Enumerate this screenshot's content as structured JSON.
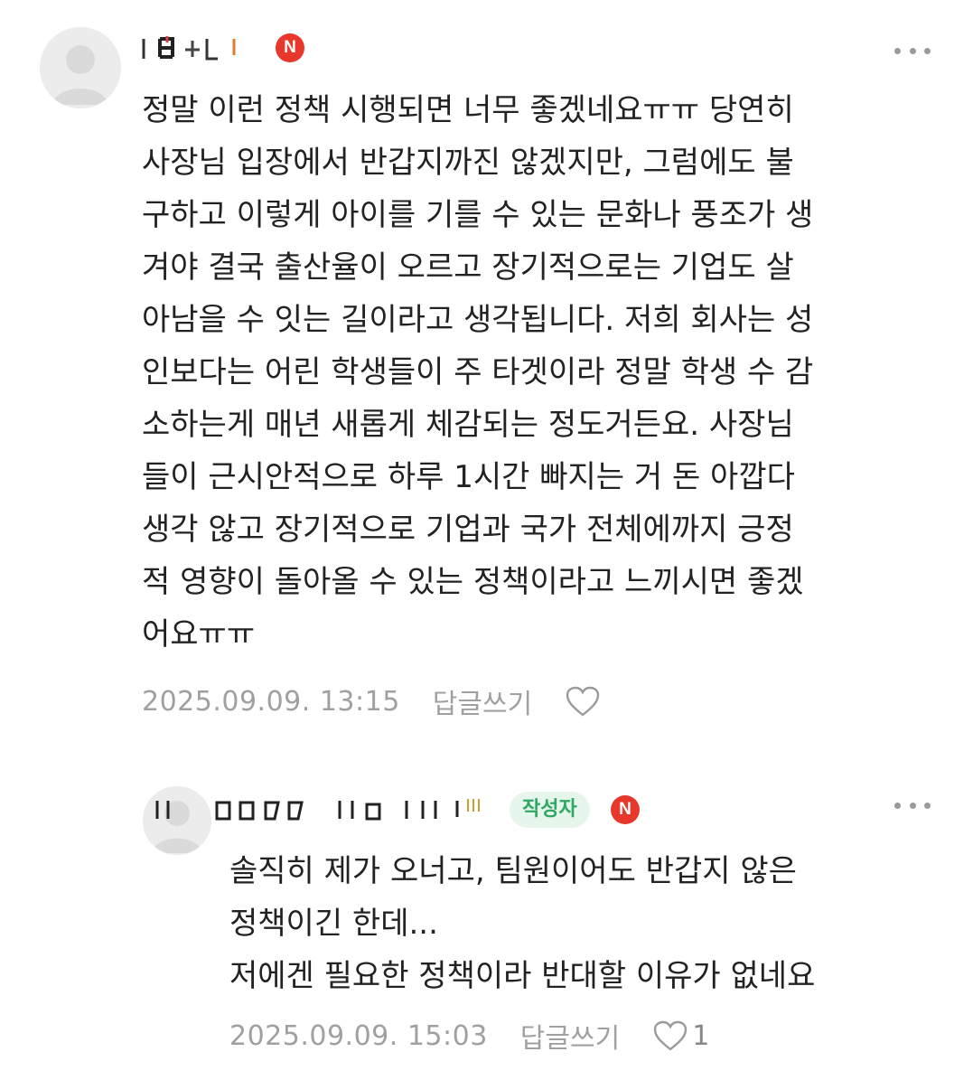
{
  "comments": [
    {
      "author_badge": "N",
      "text": "정말 이런 정책 시행되면 너무 좋겠네요ㅠㅠ 당연히\n사장님 입장에서 반갑지까진 않겠지만, 그럼에도 불\n구하고 이렇게 아이를 기를 수 있는 문화나 풍조가 생\n겨야 결국 출산율이 오르고 장기적으로는 기업도 살\n아남을 수 잇는 길이라고 생각됩니다. 저희 회사는 성\n인보다는 어린 학생들이 주 타겟이라 정말 학생 수 감\n소하는게 매년 새롭게 체감되는 정도거든요. 사장님\n들이 근시안적으로 하루 1시간 빠지는 거 돈 아깝다\n생각 않고 장기적으로 기업과 국가 전체에까지 긍정\n적 영향이 돌아올 수 있는 정책이라고 느끼시면 좋겠\n어요ㅠㅠ",
      "date": "2025.09.09. 13:15",
      "reply_label": "답글쓰기",
      "like_icon": "heart-outline-icon",
      "like_count": ""
    },
    {
      "author_tag": "작성자",
      "author_badge": "N",
      "text": "솔직히 제가 오너고, 팀원이어도 반갑지 않은\n정책이긴 한데...\n저에겐 필요한 정책이라 반대할 이유가 없네요",
      "date": "2025.09.09. 15:03",
      "reply_label": "답글쓰기",
      "like_icon": "heart-outline-icon",
      "like_count": "1"
    }
  ],
  "colors": {
    "badge_red": "#e8372b",
    "author_tag_bg": "#e6f6ec",
    "author_tag_text": "#2fa864",
    "meta_gray": "#a0a0a0",
    "text": "#222222"
  }
}
